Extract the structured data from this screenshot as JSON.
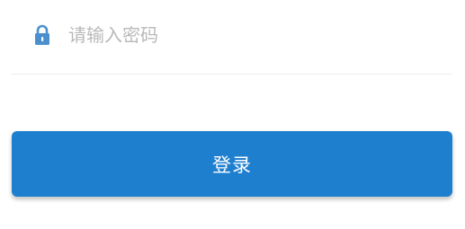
{
  "password_field": {
    "icon": "lock-icon",
    "placeholder": "请输入密码",
    "value": ""
  },
  "login_button": {
    "label": "登录"
  },
  "colors": {
    "accent": "#1f7fcf",
    "icon": "#4a90cf",
    "placeholder": "#b9b9b9",
    "divider": "#ececec"
  }
}
